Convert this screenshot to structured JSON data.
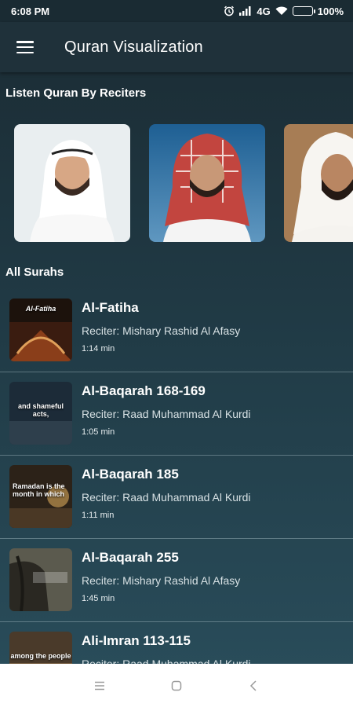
{
  "status_bar": {
    "time": "6:08 PM",
    "network": "4G",
    "battery_percent": "100%",
    "icons": [
      "alarm-icon",
      "signal-icon",
      "wifi-icon",
      "battery-icon"
    ]
  },
  "app_bar": {
    "title": "Quran Visualization",
    "menu_icon": "hamburger-menu-icon"
  },
  "reciters_section": {
    "title": "Listen Quran By Reciters",
    "reciters": [
      {
        "image": "reciter-photo-white-ghutra"
      },
      {
        "image": "reciter-photo-red-shemagh"
      },
      {
        "image": "reciter-photo-white-ghutra-partial"
      }
    ]
  },
  "surahs_section": {
    "title": "All Surahs",
    "items": [
      {
        "name": "Al-Fatiha",
        "reciter": "Reciter: Mishary Rashid Al Afasy",
        "duration": "1:14 min",
        "thumb_caption": "Al-Fatiha"
      },
      {
        "name": "Al-Baqarah 168-169",
        "reciter": "Reciter: Raad Muhammad Al Kurdi",
        "duration": "1:05 min",
        "thumb_caption": "and shameful acts,"
      },
      {
        "name": "Al-Baqarah 185",
        "reciter": "Reciter: Raad Muhammad Al Kurdi",
        "duration": "1:11 min",
        "thumb_caption": "Ramadan is the month in which"
      },
      {
        "name": "Al-Baqarah 255",
        "reciter": "Reciter: Mishary Rashid Al Afasy",
        "duration": "1:45 min",
        "thumb_caption": ""
      },
      {
        "name": "Ali-Imran 113-115",
        "reciter": "Reciter: Raad Muhammad Al Kurdi",
        "duration": "",
        "thumb_caption": "among the people"
      }
    ]
  },
  "nav_bar": {
    "icons": [
      "recents-icon",
      "home-icon",
      "back-icon"
    ]
  },
  "colors": {
    "app_bar": "#1f313a",
    "background_top": "#1b2b33",
    "background_bottom": "#2a4e5c",
    "battery": "#4cd964"
  }
}
